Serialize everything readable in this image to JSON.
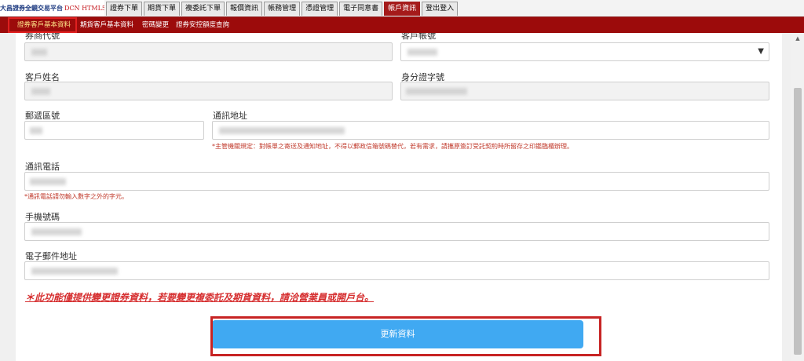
{
  "brand": {
    "name": "大昌證券全鏡交易平台",
    "version": "DCN HTML5"
  },
  "tabs": [
    {
      "label": "證券下單",
      "active": false
    },
    {
      "label": "期貨下單",
      "active": false
    },
    {
      "label": "複委託下單",
      "active": false
    },
    {
      "label": "報價資訊",
      "active": false
    },
    {
      "label": "帳務管理",
      "active": false
    },
    {
      "label": "憑證管理",
      "active": false
    },
    {
      "label": "電子同意書",
      "active": false
    },
    {
      "label": "帳戶資訊",
      "active": true
    },
    {
      "label": "登出登入",
      "active": false
    }
  ],
  "subnav": [
    {
      "label": "證券客戶基本資料",
      "active": true
    },
    {
      "label": "期貨客戶基本資料",
      "active": false
    },
    {
      "label": "密碼變更",
      "active": false
    },
    {
      "label": "證券安控額度查詢",
      "active": false
    }
  ],
  "form": {
    "broker_code_label": "券商代號",
    "account_label": "客戶帳號",
    "name_label": "客戶姓名",
    "id_label": "身分證字號",
    "zip_label": "郵遞區號",
    "address_label": "通訊地址",
    "address_hint": "*主管機關規定：對帳單之寄送及通知地址，不得以郵政信箱號碼替代，若有需求，請攜原簽訂受託契約時所留存之印鑑臨櫃辦理。",
    "phone_label": "通訊電話",
    "phone_hint": "*通訊電話請勿輸入數字之外的字元。",
    "mobile_label": "手機號碼",
    "email_label": "電子郵件地址"
  },
  "notice": "＊此功能僅提供變更證券資料，若要變更複委託及期貨資料，請洽營業員或開戶台。",
  "update_button": "更新資料",
  "colors": {
    "header_red": "#9c0b0b",
    "button_blue": "#40a9f2",
    "notice_red": "#d63031"
  },
  "icons": {
    "select_arrow": "chevron-down-icon",
    "scroll_up": "scroll-up-arrow-icon"
  }
}
